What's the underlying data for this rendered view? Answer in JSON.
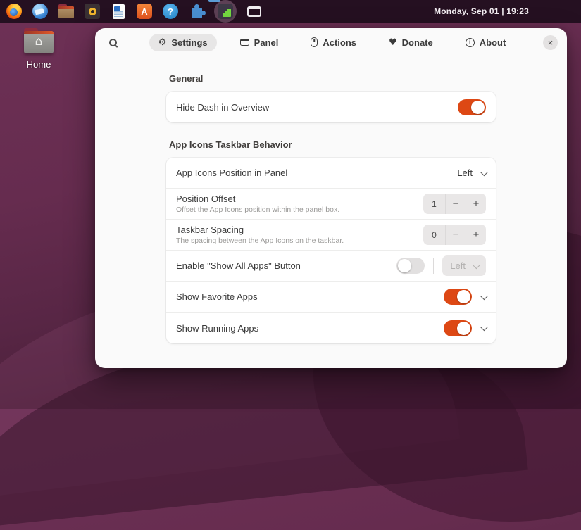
{
  "topbar": {
    "clock": "Monday, Sep 01 | 19:23",
    "app_icons": [
      "firefox",
      "thunderbird",
      "files",
      "rhythmbox",
      "libreoffice-writer",
      "app-center",
      "help",
      "gnome-extensions",
      "extension-manager-active",
      "window-switcher"
    ]
  },
  "desktop": {
    "home_label": "Home"
  },
  "icons": {
    "gear": "⚙",
    "heart": "♥",
    "close": "×",
    "minus": "−",
    "plus": "+",
    "house": "⌂",
    "question": "?",
    "info": "i",
    "app_center_letter": "A"
  },
  "colors": {
    "accent": "#dd4814",
    "topbar_bg": "#251021",
    "wallpaper_top": "#6e3156",
    "wallpaper_bottom": "#3c1730",
    "dialog_bg": "#fafafa",
    "card_bg": "#ffffff",
    "focus_indicator": "#5b9bd5"
  },
  "dialog": {
    "tabs": [
      {
        "label": "Settings",
        "active": true
      },
      {
        "label": "Panel",
        "active": false
      },
      {
        "label": "Actions",
        "active": false
      },
      {
        "label": "Donate",
        "active": false
      },
      {
        "label": "About",
        "active": false
      }
    ],
    "sections": [
      {
        "title": "General",
        "rows": [
          {
            "title": "Hide Dash in Overview",
            "control": "switch",
            "state": "on"
          }
        ]
      },
      {
        "title": "App Icons Taskbar Behavior",
        "rows": [
          {
            "title": "App Icons Position in Panel",
            "control": "dropdown",
            "value": "Left"
          },
          {
            "title": "Position Offset",
            "subtitle": "Offset the App Icons position within the panel box.",
            "control": "spinbox",
            "value": "1"
          },
          {
            "title": "Taskbar Spacing",
            "subtitle": "The spacing between the App Icons on the taskbar.",
            "control": "spinbox",
            "value": "0",
            "minus_disabled": true
          },
          {
            "title": "Enable \"Show All Apps\" Button",
            "control": "switch+dropdown",
            "state": "off",
            "value": "Left",
            "dropdown_disabled": true
          },
          {
            "title": "Show Favorite Apps",
            "control": "switch+expander",
            "state": "on"
          },
          {
            "title": "Show Running Apps",
            "control": "switch+expander",
            "state": "on"
          }
        ]
      }
    ]
  }
}
